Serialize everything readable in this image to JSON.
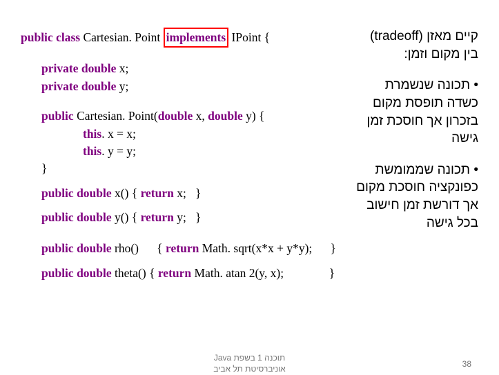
{
  "right": {
    "tradeoff_line1": "קיים מאזן (tradeoff)",
    "tradeoff_line2": "בין מקום וזמן:",
    "bullet1_l1": "• תכונה שנשמרת",
    "bullet1_l2": "כשדה תופסת מקום",
    "bullet1_l3": "בזכרון אך חוסכת זמן",
    "bullet1_l4": "גישה",
    "bullet2_l1": "• תכונה שממומשת",
    "bullet2_l2": "כפונקציה חוסכת מקום",
    "bullet2_l3": "אך דורשת זמן חישוב",
    "bullet2_l4": "בכל גישה"
  },
  "code": {
    "kw_public": "public",
    "kw_class": "class",
    "kw_private": "private",
    "kw_double": "double",
    "kw_implements": "implements",
    "kw_return": "return",
    "kw_this": "this",
    "class_decl_pre": " Cartesian. Point ",
    "class_decl_post": " IPoint {",
    "field_x": " x;",
    "field_y": " y;",
    "ctor_name": " Cartesian. Point(",
    "ctor_p1_name": " x, ",
    "ctor_p2_name": " y) {",
    "ctor_body1": ". x = x;",
    "ctor_body2": ". y = y;",
    "close_brace": "}",
    "x_sig": " x() { ",
    "x_ret": " x;   }",
    "y_sig": " y() { ",
    "y_ret": " y;   }",
    "rho_sig": " rho()      { ",
    "rho_ret": " Math. sqrt(x*x + y*y);      }",
    "theta_sig": " theta() { ",
    "theta_ret": " Math. atan 2(y, x);               }"
  },
  "footer": {
    "center_l1": "תוכנה 1 בשפת Java",
    "center_l2": "אוניברסיטת תל אביב",
    "page": "38"
  }
}
